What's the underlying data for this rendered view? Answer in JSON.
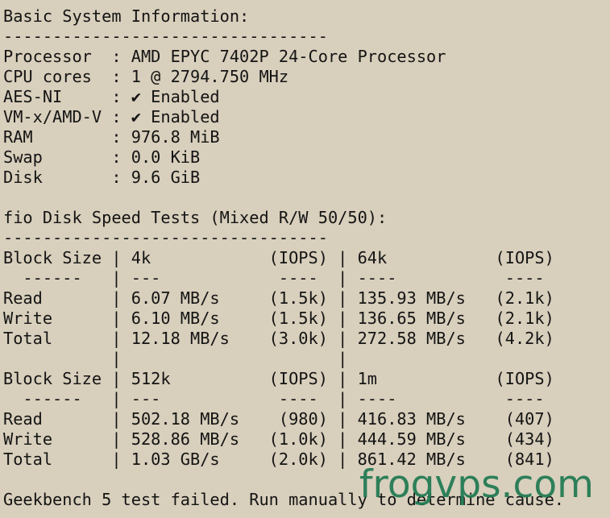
{
  "terminal": {
    "lines": [
      "Basic System Information:",
      "---------------------------------",
      "Processor  : AMD EPYC 7402P 24-Core Processor",
      "CPU cores  : 1 @ 2794.750 MHz",
      "AES-NI     : ✔ Enabled",
      "VM-x/AMD-V : ✔ Enabled",
      "RAM        : 976.8 MiB",
      "Swap       : 0.0 KiB",
      "Disk       : 9.6 GiB",
      "",
      "fio Disk Speed Tests (Mixed R/W 50/50):",
      "---------------------------------",
      "Block Size | 4k            (IOPS) | 64k           (IOPS)",
      "  ------   | ---            ----  | ----           ----",
      "Read       | 6.07 MB/s     (1.5k) | 135.93 MB/s   (2.1k)",
      "Write      | 6.10 MB/s     (1.5k) | 136.65 MB/s   (2.1k)",
      "Total      | 12.18 MB/s    (3.0k) | 272.58 MB/s   (4.2k)",
      "           |                      |",
      "Block Size | 512k          (IOPS) | 1m            (IOPS)",
      "  ------   | ---            ----  | ----           ----",
      "Read       | 502.18 MB/s    (980) | 416.83 MB/s    (407)",
      "Write      | 528.86 MB/s   (1.0k) | 444.59 MB/s    (434)",
      "Total      | 1.03 GB/s     (2.0k) | 861.42 MB/s    (841)",
      "",
      "Geekbench 5 test failed. Run manually to determine cause."
    ]
  },
  "watermark": {
    "text": "frogvps.com",
    "color": "#1f7a52"
  },
  "colors": {
    "background": "#d8cfbc",
    "text": "#141414"
  }
}
